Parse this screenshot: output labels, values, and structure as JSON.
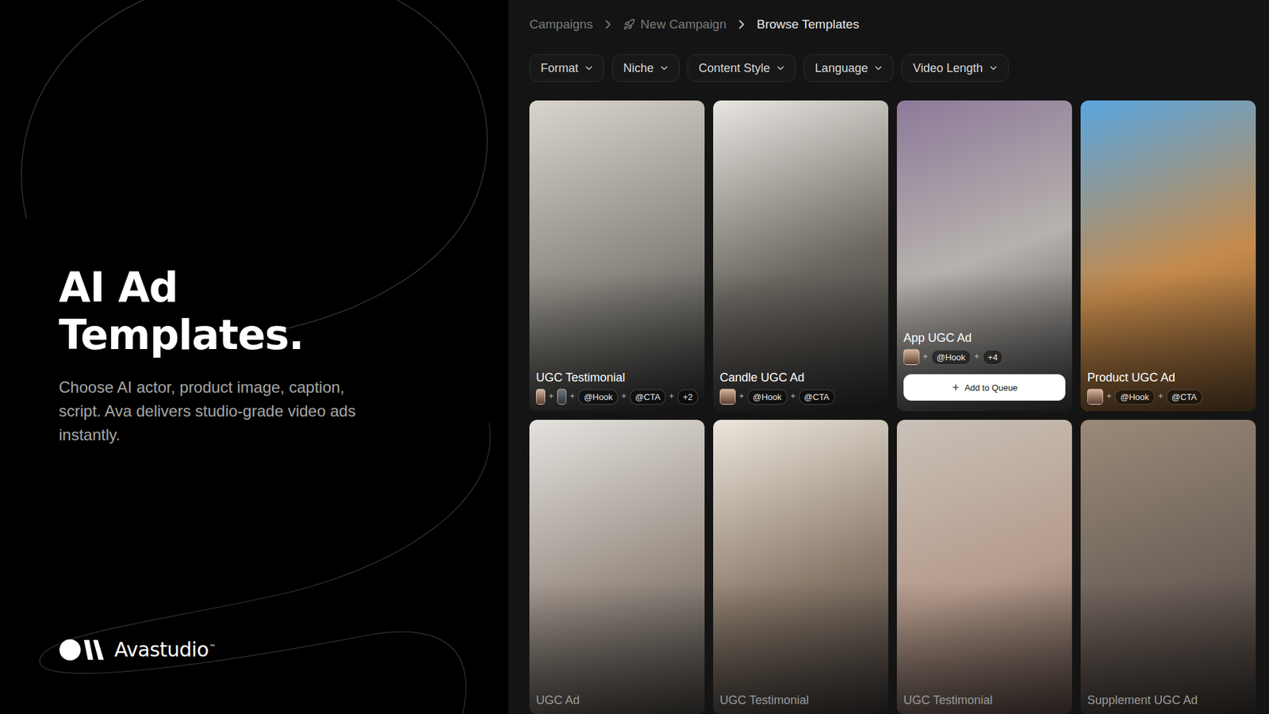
{
  "hero": {
    "title": "AI Ad Templates.",
    "subtitle": "Choose AI actor, product image, caption, script. Ava delivers studio-grade video ads instantly."
  },
  "logo": {
    "name": "Avastudio",
    "mark": "™"
  },
  "breadcrumb": [
    {
      "label": "Campaigns",
      "current": false,
      "icon": false
    },
    {
      "label": "New Campaign",
      "current": false,
      "icon": true
    },
    {
      "label": "Browse Templates",
      "current": true,
      "icon": false
    }
  ],
  "filters": [
    "Format",
    "Niche",
    "Content Style",
    "Language",
    "Video Length"
  ],
  "cards": [
    {
      "label": "UGC Testimonial",
      "avatars": 2,
      "tags": [
        "@Hook",
        "@CTA"
      ],
      "extra": "+2",
      "hovered": false,
      "button": "",
      "dim": false
    },
    {
      "label": "Candle UGC Ad",
      "avatars": 1,
      "tags": [
        "@Hook",
        "@CTA"
      ],
      "extra": "",
      "hovered": false,
      "button": "",
      "dim": false
    },
    {
      "label": "App UGC Ad",
      "avatars": 1,
      "tags": [
        "@Hook"
      ],
      "extra": "+4",
      "hovered": true,
      "button": "Add to Queue",
      "dim": false
    },
    {
      "label": "Product UGC Ad",
      "avatars": 1,
      "tags": [
        "@Hook",
        "@CTA"
      ],
      "extra": "",
      "hovered": false,
      "button": "",
      "dim": false
    },
    {
      "label": "UGC Ad",
      "avatars": 0,
      "tags": [],
      "extra": "",
      "hovered": false,
      "button": "",
      "dim": true
    },
    {
      "label": "UGC Testimonial",
      "avatars": 0,
      "tags": [],
      "extra": "",
      "hovered": false,
      "button": "",
      "dim": true
    },
    {
      "label": "UGC Testimonial",
      "avatars": 0,
      "tags": [],
      "extra": "",
      "hovered": false,
      "button": "",
      "dim": true
    },
    {
      "label": "Supplement UGC Ad",
      "avatars": 0,
      "tags": [],
      "extra": "",
      "hovered": false,
      "button": "",
      "dim": true
    }
  ]
}
